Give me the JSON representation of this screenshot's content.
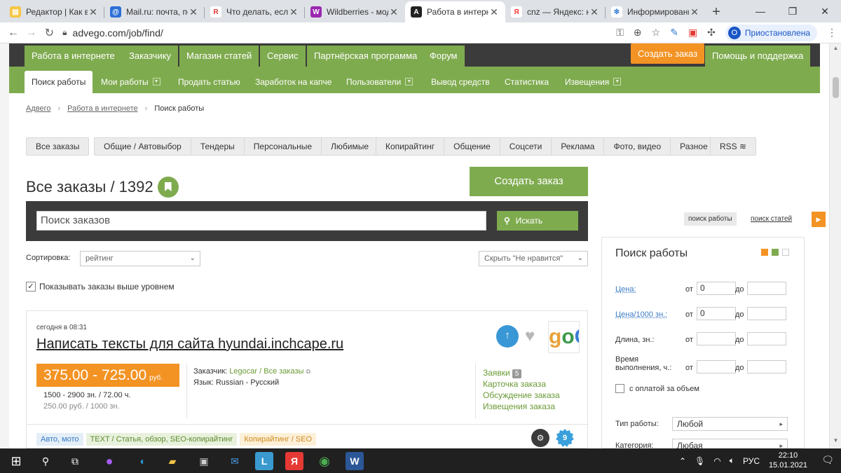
{
  "browser": {
    "tabs": [
      {
        "title": "Редактор | Как вы",
        "fav_text": "▤",
        "fav_color": "#f7c744",
        "active": false
      },
      {
        "title": "Mail.ru: почта, по",
        "fav_text": "@",
        "fav_color": "#2d6fd6",
        "active": false
      },
      {
        "title": "Что делать, если у",
        "fav_text": "R",
        "fav_color": "#e53935",
        "active": false
      },
      {
        "title": "Wildberries - мод",
        "fav_text": "W",
        "fav_color": "#9b27b0",
        "active": false
      },
      {
        "title": "Работа в интерне",
        "fav_text": "A",
        "fav_color": "#222222",
        "active": true
      },
      {
        "title": "cnz — Яндекс: на",
        "fav_text": "Я",
        "fav_color": "#ff3333",
        "active": false
      },
      {
        "title": "Информировани",
        "fav_text": "✻",
        "fav_color": "#3a7ed6",
        "active": false
      }
    ],
    "url": "advego.com/job/find/",
    "profile_initial": "О",
    "profile_label": "Приостановлена"
  },
  "site": {
    "topnav": [
      {
        "label": "Работа в интернете"
      },
      {
        "label": "Заказчику"
      },
      {
        "label": "Магазин статей"
      },
      {
        "label": "Сервис"
      },
      {
        "label": "Партнёрская программа"
      },
      {
        "label": "Форум"
      },
      {
        "label": "Создать заказ"
      },
      {
        "label": "Помощь и поддержка"
      }
    ],
    "subnav": [
      {
        "label": "Поиск работы"
      },
      {
        "label": "Мои работы"
      },
      {
        "label": "Продать статью"
      },
      {
        "label": "Заработок на капче"
      },
      {
        "label": "Пользователи"
      },
      {
        "label": "Вывод средств"
      },
      {
        "label": "Статистика"
      },
      {
        "label": "Извещения"
      }
    ],
    "breadcrumbs": [
      "Адвего",
      "Работа в интернете",
      "Поиск работы"
    ],
    "filters_a": [
      "Все заказы"
    ],
    "filters_b": [
      "Общие / Автовыбор",
      "Тендеры",
      "Персональные",
      "Любимые"
    ],
    "filters_c": [
      "Копирайтинг",
      "Общение",
      "Соцсети",
      "Реклама",
      "Фото, видео",
      "Разное"
    ],
    "filters_d": [
      "RSS"
    ],
    "heading": "Все заказы / 1392",
    "create_button": "Создать заказ",
    "search": {
      "placeholder": "Поиск заказов",
      "button": "Искать"
    },
    "sort_label": "Сортировка:",
    "sort_value": "рейтинг",
    "hide_value": "Скрыть \"Не нравится\"",
    "show_above_level": "Показывать заказы выше уровнем",
    "order": {
      "date": "сегодня в 08:31",
      "title": "Написать тексты для сайта hyundai.inchcape.ru",
      "price": "375.00 - 725.00",
      "currency": "руб.",
      "length_line": "1500 - 2900 зн. / 72.00 ч.",
      "rate_line": "250.00 руб. / 1000 зн.",
      "customer_label": "Заказчик:",
      "customer_name": "Legocar",
      "customer_sep": "/",
      "customer_all": "Все заказы",
      "language_label": "Язык:",
      "language_value": "Russian - Русский",
      "links": [
        "Заявки",
        "Карточка заказа",
        "Обсуждение заказа",
        "Извещения заказа"
      ],
      "applications_count": "5",
      "tags": [
        "Авто, мото",
        "TEXT / Статья, обзор, SEO-копирайтинг",
        "Копирайтинг / SEO"
      ],
      "level_badge": "9",
      "logo_text": {
        "g": "g",
        "o1": "o",
        "o2": "C"
      }
    },
    "right_panel": {
      "pill_jobs": "поиск работы",
      "pill_articles": "поиск статей",
      "title": "Поиск работы",
      "price_label": "Цена:",
      "price_per_label": "Цена/1000 зн.:",
      "length_label": "Длина, зн.:",
      "time_label_1": "Время",
      "time_label_2": "выполнения, ч.:",
      "from": "от",
      "to": "до",
      "price_from": "0",
      "price_per_from": "0",
      "volume_pay": "с оплатой за объем",
      "work_type_label": "Тип работы:",
      "work_type_value": "Любой",
      "category_label": "Категория:",
      "category_value": "Любая"
    }
  },
  "taskbar": {
    "lang": "РУС",
    "time": "22:10",
    "date": "15.01.2021"
  },
  "colors": {
    "green": "#7fab4f",
    "dark": "#3b3b3b",
    "orange": "#f39324",
    "link_blue": "#3a7bc4"
  }
}
